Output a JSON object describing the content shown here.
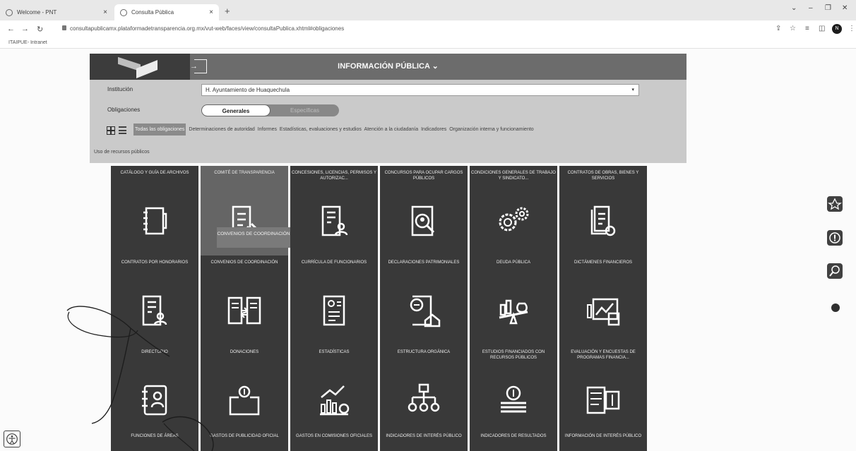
{
  "browser": {
    "tabs": [
      {
        "title": "Welcome - PNT"
      },
      {
        "title": "Consulta Pública"
      }
    ],
    "new_tab": "+",
    "url": "consultapublicamx.plataformadetransparencia.org.mx/vut-web/faces/view/consultaPublica.xhtml#obligaciones",
    "bookmark": "ITAIPUE- Intranet",
    "profile_initial": "N"
  },
  "portal": {
    "title": "INFORMACIÓN PÚBLICA ⌄",
    "institution_label": "Institución",
    "institution_value": "H. Ayuntamiento de Huaquechula",
    "obligations_label": "Obligaciones",
    "tab_general": "Generales",
    "tab_specific": "Específicas",
    "categories": [
      "Todas las obligaciones",
      "Determinaciones de autoridad",
      "Informes",
      "Estadísticas, evaluaciones y estudios",
      "Atención a la ciudadanía",
      "Indicadores",
      "Organización interna y funcionamiento"
    ],
    "category_extra": "Uso de recursos públicos",
    "tooltip": "CONVENIOS DE COORDINACIÓN"
  },
  "tiles": [
    {
      "title": "CATÁLOGO Y GUÍA DE ARCHIVOS",
      "icon": "binder-icon"
    },
    {
      "title": "COMITÉ DE TRANSPARENCIA",
      "icon": "document-gavel-icon"
    },
    {
      "title": "CONCESIONES, LICENCIAS, PERMISOS Y AUTORIZAC...",
      "icon": "document-person-icon"
    },
    {
      "title": "CONCURSOS PARA OCUPAR CARGOS PÚBLICOS",
      "icon": "search-person-icon"
    },
    {
      "title": "CONDICIONES GENERALES DE TRABAJO Y SINDICATO...",
      "icon": "gears-icon"
    },
    {
      "title": "CONTRATOS DE OBRAS, BIENES Y SERVICIOS",
      "icon": "documents-check-icon"
    },
    {
      "title": "CONTRATOS POR HONORARIOS",
      "icon": "document-user-icon"
    },
    {
      "title": "CONVENIOS DE COORDINACIÓN",
      "icon": "exchange-documents-icon"
    },
    {
      "title": "CURRÍCULA DE FUNCIONARIOS",
      "icon": "resume-icon"
    },
    {
      "title": "DECLARACIONES PATRIMONIALES",
      "icon": "document-house-icon"
    },
    {
      "title": "DEUDA PÚBLICA",
      "icon": "balance-money-icon"
    },
    {
      "title": "DICTÁMENES FINANCIEROS",
      "icon": "financial-chart-icon"
    },
    {
      "title": "DIRECTORIO",
      "icon": "directory-icon"
    },
    {
      "title": "DONACIONES",
      "icon": "donation-box-icon"
    },
    {
      "title": "ESTADÍSTICAS",
      "icon": "statistics-icon"
    },
    {
      "title": "ESTRUCTURA ORGÁNICA",
      "icon": "org-chart-icon"
    },
    {
      "title": "ESTUDIOS FINANCIADOS CON RECURSOS PÚBLICOS",
      "icon": "coins-icon"
    },
    {
      "title": "EVALUACIÓN Y ENCUESTAS DE PROGRAMAS FINANCIA...",
      "icon": "checklist-money-icon"
    },
    {
      "title": "FUNCIONES DE ÁREAS",
      "icon": ""
    },
    {
      "title": "GASTOS DE PUBLICIDAD OFICIAL",
      "icon": ""
    },
    {
      "title": "GASTOS EN COMISIONES OFICIALES",
      "icon": ""
    },
    {
      "title": "INDICADORES DE INTERÉS PÚBLICO",
      "icon": ""
    },
    {
      "title": "INDICADORES DE RESULTADOS",
      "icon": ""
    },
    {
      "title": "INFORMACIÓN DE INTERÉS PÚBLICO",
      "icon": ""
    }
  ]
}
